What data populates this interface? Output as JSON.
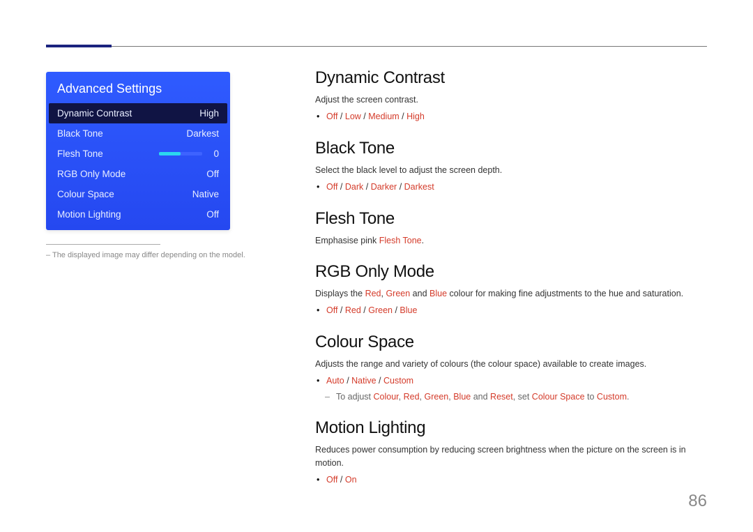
{
  "pageNumber": "86",
  "osd": {
    "title": "Advanced Settings",
    "rows": [
      {
        "label": "Dynamic Contrast",
        "value": "High",
        "selected": true,
        "type": "text"
      },
      {
        "label": "Black Tone",
        "value": "Darkest",
        "type": "text"
      },
      {
        "label": "Flesh Tone",
        "value": "0",
        "type": "slider"
      },
      {
        "label": "RGB Only Mode",
        "value": "Off",
        "type": "text"
      },
      {
        "label": "Colour Space",
        "value": "Native",
        "type": "text"
      },
      {
        "label": "Motion Lighting",
        "value": "Off",
        "type": "text"
      }
    ]
  },
  "footnote": "– The displayed image may differ depending on the model.",
  "sections": {
    "dynamicContrast": {
      "title": "Dynamic Contrast",
      "desc": "Adjust the screen contrast.",
      "opts": [
        "Off",
        "Low",
        "Medium",
        "High"
      ]
    },
    "blackTone": {
      "title": "Black Tone",
      "desc": "Select the black level to adjust the screen depth.",
      "opts": [
        "Off",
        "Dark",
        "Darker",
        "Darkest"
      ]
    },
    "fleshTone": {
      "title": "Flesh Tone",
      "descPre": "Emphasise pink ",
      "descRed": "Flesh Tone",
      "descPost": "."
    },
    "rgbOnly": {
      "title": "RGB Only Mode",
      "descPre": "Displays the ",
      "r": "Red",
      "c1": ", ",
      "g": "Green",
      "c2": " and ",
      "b": "Blue",
      "descPost": " colour for making fine adjustments to the hue and saturation.",
      "opts": [
        "Off",
        "Red",
        "Green",
        "Blue"
      ]
    },
    "colourSpace": {
      "title": "Colour Space",
      "desc": "Adjusts the range and variety of colours (the colour space) available to create images.",
      "opts": [
        "Auto",
        "Native",
        "Custom"
      ],
      "sub": {
        "pre": "To adjust ",
        "w1": "Colour",
        "s1": ", ",
        "w2": "Red",
        "s2": ", ",
        "w3": "Green",
        "s3": ", ",
        "w4": "Blue",
        "s4": " and ",
        "w5": "Reset",
        "s5": ", set ",
        "w6": "Colour Space",
        "s6": " to ",
        "w7": "Custom",
        "s7": "."
      }
    },
    "motionLighting": {
      "title": "Motion Lighting",
      "desc": "Reduces power consumption by reducing screen brightness when the picture on the screen is in motion.",
      "opts": [
        "Off",
        "On"
      ]
    }
  },
  "slash": " / "
}
